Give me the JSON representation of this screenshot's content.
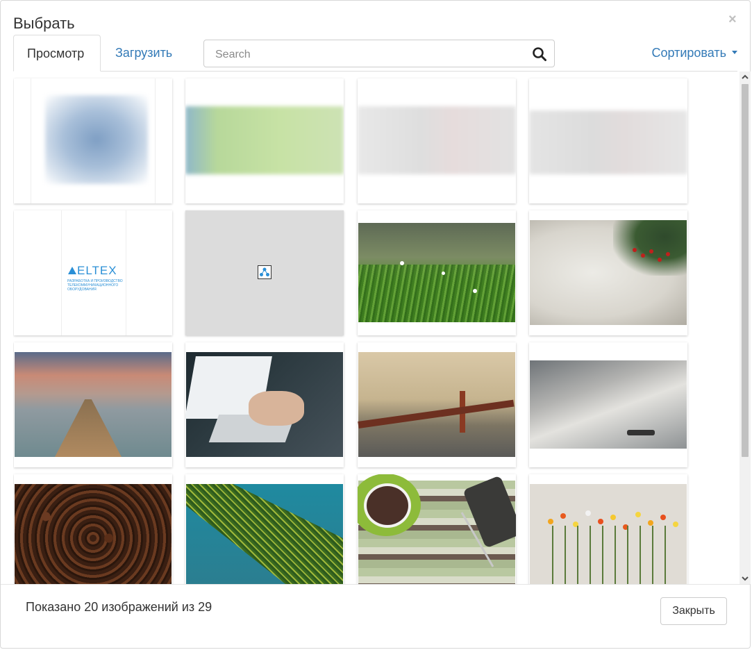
{
  "modal": {
    "title": "Выбрать",
    "close_symbol": "×"
  },
  "tabs": [
    {
      "label": "Просмотр",
      "active": true
    },
    {
      "label": "Загрузить",
      "active": false
    }
  ],
  "search": {
    "placeholder": "Search",
    "value": "",
    "icon": "search-icon"
  },
  "sort": {
    "label": "Сортировать",
    "icon": "caret-down-icon"
  },
  "gallery": {
    "eltex_logo_text": "ELTEX",
    "eltex_tagline": "РАЗРАБОТКА И ПРОИЗВОДСТВО ТЕЛЕКОММУНИКАЦИОННОГО ОБОРУДОВАНИЯ",
    "images": [
      {
        "subject": "blurred-blue-thumbnail"
      },
      {
        "subject": "blurred-green-banner"
      },
      {
        "subject": "blurred-grey-banner"
      },
      {
        "subject": "blurred-grey-banner"
      },
      {
        "subject": "eltex-logo-document"
      },
      {
        "subject": "broken-image-placeholder"
      },
      {
        "subject": "grass-with-white-flowers"
      },
      {
        "subject": "fir-branch-with-red-berries"
      },
      {
        "subject": "pier-at-sunset"
      },
      {
        "subject": "hands-typing-on-laptop"
      },
      {
        "subject": "golden-gate-bridge"
      },
      {
        "subject": "bridge-in-fog"
      },
      {
        "subject": "coffee-beans"
      },
      {
        "subject": "palm-leaf"
      },
      {
        "subject": "coffee-cup-and-phone"
      },
      {
        "subject": "flowers-on-table"
      }
    ]
  },
  "footer": {
    "status": "Показано 20 изображений из 29",
    "close_button": "Закрыть"
  },
  "colors": {
    "link": "#337ab7",
    "border": "#dddddd",
    "scroll_thumb": "#c1c1c1"
  }
}
